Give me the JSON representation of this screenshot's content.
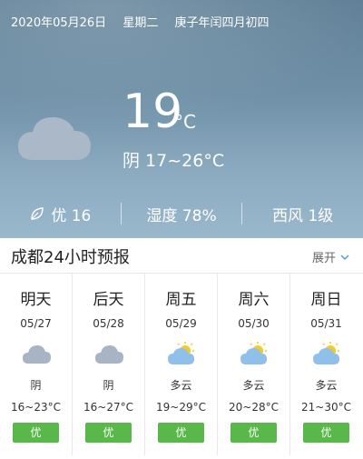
{
  "header": {
    "date": "2020年05月26日",
    "weekday": "星期二",
    "lunar": "庚子年闰四月初四"
  },
  "current": {
    "temp": "19",
    "unit": "°C",
    "condition_range": "阴 17~26°C",
    "icon": "cloud-moon-icon"
  },
  "stats": {
    "aqi": "优 16",
    "humidity": "湿度 78%",
    "wind": "西风 1级"
  },
  "forecast": {
    "title": "成都24小时预报",
    "expand": "展开",
    "days": [
      {
        "name": "明天",
        "date": "05/27",
        "icon": "cloudy-icon",
        "condition": "阴",
        "range": "16~23°C",
        "aqi": "优"
      },
      {
        "name": "后天",
        "date": "05/28",
        "icon": "cloudy-icon",
        "condition": "阴",
        "range": "16~27°C",
        "aqi": "优"
      },
      {
        "name": "周五",
        "date": "05/29",
        "icon": "partly-cloudy-icon",
        "condition": "多云",
        "range": "19~29°C",
        "aqi": "优"
      },
      {
        "name": "周六",
        "date": "05/30",
        "icon": "partly-cloudy-icon",
        "condition": "多云",
        "range": "20~28°C",
        "aqi": "优"
      },
      {
        "name": "周日",
        "date": "05/31",
        "icon": "partly-cloudy-icon",
        "condition": "多云",
        "range": "21~30°C",
        "aqi": "优"
      }
    ]
  },
  "colors": {
    "aqi_good": "#5ab84a",
    "sky": "#6f90a7"
  }
}
